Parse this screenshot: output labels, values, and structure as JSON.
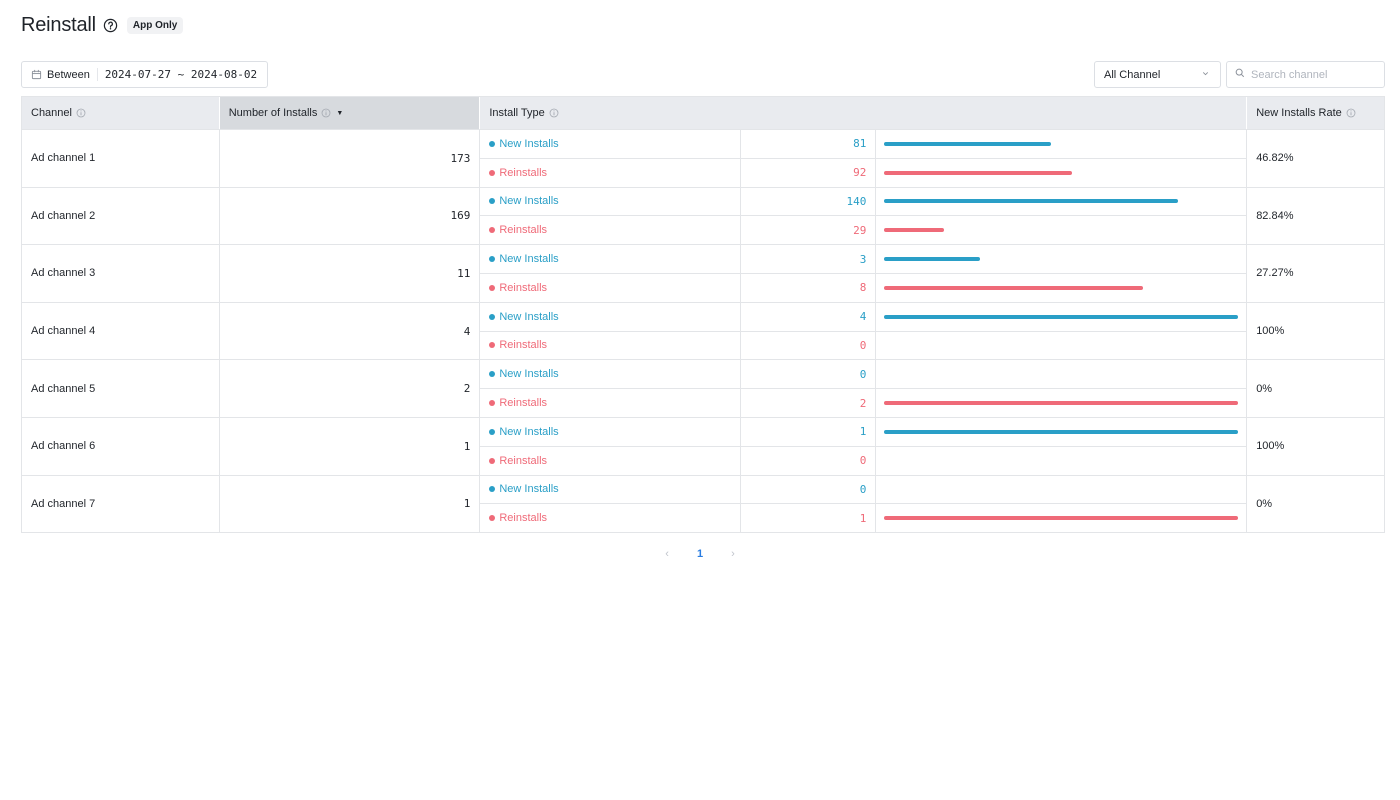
{
  "header": {
    "title": "Reinstall",
    "badge": "App Only"
  },
  "filters": {
    "date_label": "Between",
    "date_range": "2024-07-27 ~ 2024-08-02",
    "channel_select": "All Channel",
    "search_placeholder": "Search channel"
  },
  "table": {
    "columns": {
      "channel": "Channel",
      "installs": "Number of Installs",
      "install_type": "Install Type",
      "rate": "New Installs Rate"
    },
    "type_labels": {
      "new": "New Installs",
      "re": "Reinstalls"
    },
    "rows": [
      {
        "channel": "Ad channel 1",
        "total": "173",
        "new": "81",
        "re": "92",
        "new_frac": 0.47,
        "re_frac": 0.53,
        "rate": "46.82%"
      },
      {
        "channel": "Ad channel 2",
        "total": "169",
        "new": "140",
        "re": "29",
        "new_frac": 0.83,
        "re_frac": 0.17,
        "rate": "82.84%"
      },
      {
        "channel": "Ad channel 3",
        "total": "11",
        "new": "3",
        "re": "8",
        "new_frac": 0.27,
        "re_frac": 0.73,
        "rate": "27.27%"
      },
      {
        "channel": "Ad channel 4",
        "total": "4",
        "new": "4",
        "re": "0",
        "new_frac": 1,
        "re_frac": 0,
        "rate": "100%"
      },
      {
        "channel": "Ad channel 5",
        "total": "2",
        "new": "0",
        "re": "2",
        "new_frac": 0,
        "re_frac": 1,
        "rate": "0%"
      },
      {
        "channel": "Ad channel 6",
        "total": "1",
        "new": "1",
        "re": "0",
        "new_frac": 1,
        "re_frac": 0,
        "rate": "100%"
      },
      {
        "channel": "Ad channel 7",
        "total": "1",
        "new": "0",
        "re": "1",
        "new_frac": 0,
        "re_frac": 1,
        "rate": "0%"
      }
    ]
  },
  "pagination": {
    "current": "1",
    "prev": "‹",
    "next": "›"
  },
  "colors": {
    "new": "#2a9fc7",
    "re": "#ef6a78"
  }
}
